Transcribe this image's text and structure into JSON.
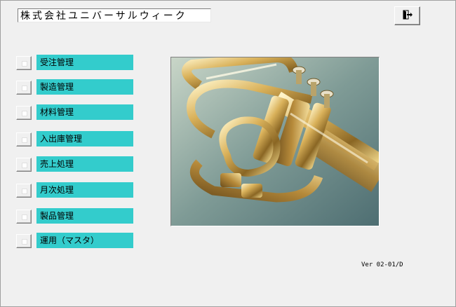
{
  "header": {
    "company_name": "株式会社ユニバーサルウィーク",
    "exit_button_icon": "exit-door-icon"
  },
  "menu": {
    "items": [
      {
        "label": "受注管理"
      },
      {
        "label": "製造管理"
      },
      {
        "label": "材料管理"
      },
      {
        "label": "入出庫管理"
      },
      {
        "label": "売上処理"
      },
      {
        "label": "月次処理"
      },
      {
        "label": "製品管理"
      },
      {
        "label": "運用（マスタ）"
      }
    ],
    "label_color": "#33cccc"
  },
  "image": {
    "subject": "trumpet-photo"
  },
  "footer": {
    "version": "Ver 02-01/D"
  }
}
